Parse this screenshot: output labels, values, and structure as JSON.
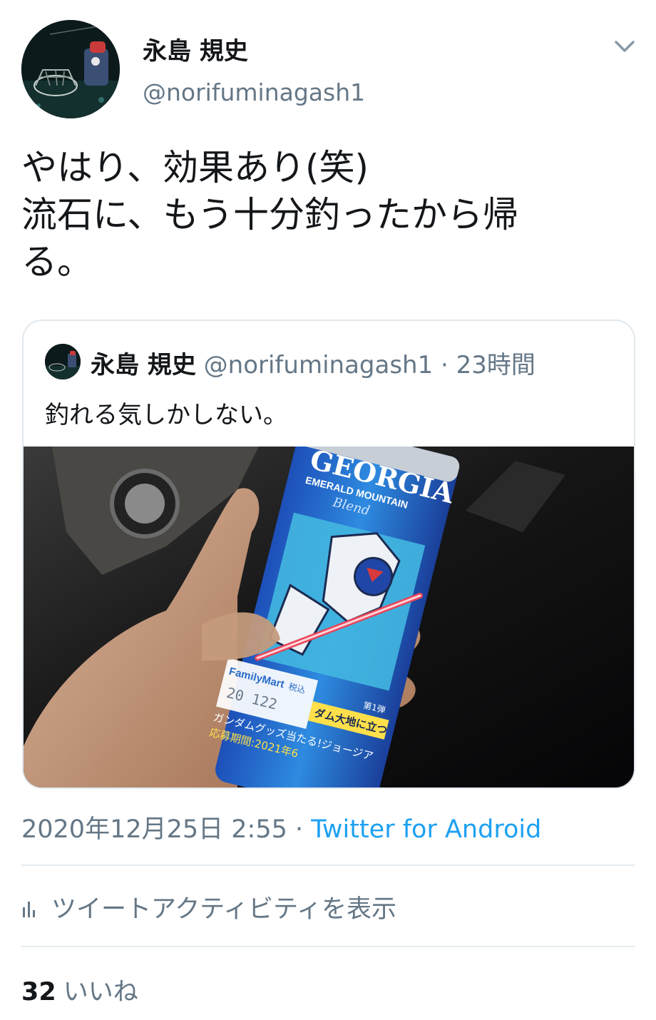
{
  "author": {
    "display_name": "永島 規史",
    "handle": "@norifuminagash1"
  },
  "tweet": {
    "text": "やはり、効果あり(笑)\n流石に、もう十分釣ったから帰\nる。"
  },
  "quoted_tweet": {
    "display_name": "永島 規史",
    "handle": "@norifuminagash1",
    "separator": "·",
    "time": "23時間",
    "text": "釣れる気しかしない。",
    "media": {
      "can_brand": "GEORGIA",
      "can_subtitle": "EMERALD MOUNTAIN",
      "can_blend": "Blend",
      "price_tag_store": "FamilyMart",
      "price_tag_tax": "税込",
      "price_tag_code": "20 122",
      "campaign_line1": "ガンダムグッズ当たる!ジョージア",
      "campaign_line2": "応募期間:2021年6",
      "campaign_badge": "第1弾",
      "campaign_banner": "ダム大地に立つ"
    }
  },
  "meta": {
    "timestamp": "2020年12月25日 2:55",
    "separator": "·",
    "source": "Twitter for Android"
  },
  "activity_label": "ツイートアクティビティを表示",
  "likes": {
    "count": "32",
    "label": "いいね"
  },
  "icons": {
    "caret": "chevron-down-icon",
    "activity": "bar-chart-icon"
  },
  "colors": {
    "link": "#1da1f2",
    "secondary_text": "#657786",
    "border": "#e1e8ed"
  }
}
